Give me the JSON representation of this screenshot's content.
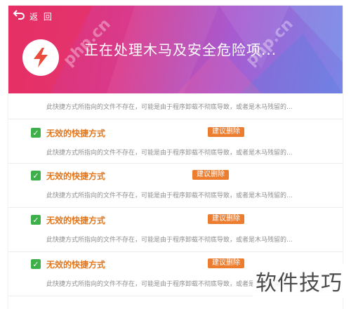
{
  "header": {
    "back_label": "返 回",
    "title": "正在处理木马及安全危险项..."
  },
  "items": [
    {
      "title": "",
      "checked": false,
      "action": "",
      "desc": "此快捷方式所指向的文件不存在，可能是由于程序卸载不彻底导致，或者是木马残留的..."
    },
    {
      "title": "无效的快捷方式",
      "checked": true,
      "action": "建议删除",
      "desc": "此快捷方式所指向的文件不存在，可能是由于程序卸载不彻底导致，或者是木马残留的..."
    },
    {
      "title": "无效的快捷方式",
      "checked": true,
      "action": "建议删除",
      "desc": "此快捷方式所指向的文件不存在，可能是由于程序卸载不彻底导致，或者是木马残留的..."
    },
    {
      "title": "无效的快捷方式",
      "checked": true,
      "action": "建议删除",
      "desc": "此快捷方式所指向的文件不存在，可能是由于程序卸载不彻底导致，或者是木马残留的..."
    },
    {
      "title": "无效的快捷方式",
      "checked": true,
      "action": "建议删除",
      "desc": "此快捷方式所指向的文件不存在，可能是由于程序卸载不彻底导致，或者是木马残留的..."
    }
  ],
  "watermark": {
    "site": "php.cn",
    "corner": "软件技巧"
  },
  "colors": {
    "accent": "#e1761e",
    "button": "#ec7c2e",
    "check": "#3eb049"
  },
  "icons": {
    "back": "back-arrow-icon",
    "bolt": "lightning-bolt-icon",
    "check": "checkmark-icon"
  }
}
